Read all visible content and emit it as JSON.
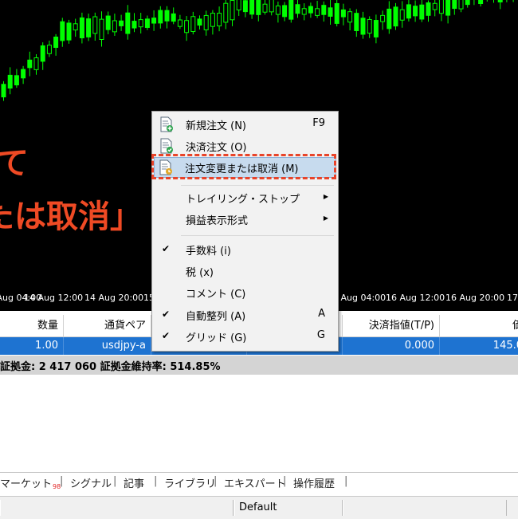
{
  "overlay": {
    "line1": "て",
    "line2": "たは取消」"
  },
  "time_axis": {
    "labels": [
      "14 Aug 04:00",
      "14 Aug 12:00",
      "14 Aug 20:00",
      "15",
      "16 Aug 04:00",
      "16 Aug 12:00",
      "16 Aug 20:00",
      "17"
    ]
  },
  "context_menu": {
    "items": [
      {
        "label": "新規注文 (N)",
        "shortcut": "F9",
        "icon": "new-order-icon"
      },
      {
        "label": "決済注文 (O)",
        "shortcut": "",
        "icon": "close-order-icon"
      },
      {
        "label": "注文変更または取消 (M)",
        "shortcut": "",
        "icon": "modify-order-icon",
        "highlighted": true
      },
      {
        "label": "トレイリング・ストップ",
        "submenu": true
      },
      {
        "label": "損益表示形式",
        "submenu": true
      },
      {
        "label": "手数料 (i)",
        "checked": true
      },
      {
        "label": "税 (x)",
        "checked": false
      },
      {
        "label": "コメント (C)",
        "checked": false
      },
      {
        "label": "自動整列 (A)",
        "shortcut": "A",
        "checked": true
      },
      {
        "label": "グリッド (G)",
        "shortcut": "G",
        "checked": true
      }
    ],
    "check_glyph": "✔",
    "arrow_glyph": "▶"
  },
  "trade_table": {
    "headers": [
      "数量",
      "通貨ペア",
      "",
      "",
      "決済指値(T/P)",
      "価"
    ],
    "row": [
      "1.00",
      "usdjpy-a",
      "",
      "",
      "0.000",
      "145.0"
    ],
    "summary": "証拠金: 2 417 060  証拠金維持率: 514.85%"
  },
  "tabs": {
    "items": [
      "マーケット",
      "シグナル",
      "記事",
      "ライブラリ",
      "エキスパート",
      "操作履歴"
    ],
    "market_badge": "98",
    "separator": "|"
  },
  "status_bar": {
    "profile": "Default"
  },
  "colors": {
    "chart_bg": "#000000",
    "candle": "#00ff00",
    "overlay_text": "#ef4a24",
    "row_selected": "#1e73d1",
    "highlight_border": "#e8442a"
  }
}
